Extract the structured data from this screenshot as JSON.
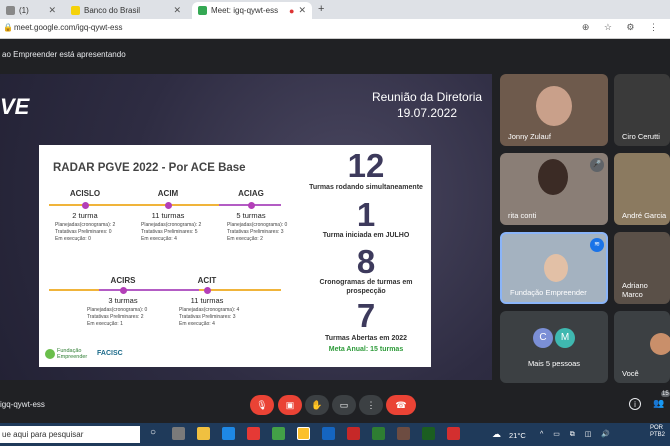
{
  "browser": {
    "tabs": [
      {
        "label": "(1)",
        "active": false
      },
      {
        "label": "Banco do Brasil",
        "active": false
      },
      {
        "label": "Meet: igq-qywt-ess",
        "active": true
      }
    ],
    "new_tab": "+",
    "url": "meet.google.com/igq-qywt-ess"
  },
  "presenting_text": "ao Empreender está apresentando",
  "slide": {
    "logo_partial": "VE",
    "meeting_title": "Reunião da Diretoria",
    "meeting_date": "19.07.2022",
    "card_title": "RADAR PGVE 2022 - Por ACE Base",
    "groups": [
      {
        "name": "ACISLO",
        "turmas": "2 turma",
        "details": [
          "Planejadas(cronograma): 2",
          "Tratativas Preliminares: 0",
          "Em execução: 0"
        ]
      },
      {
        "name": "ACIM",
        "turmas": "11 turmas",
        "details": [
          "Planejadas(cronograma): 2",
          "Tratativas Preliminares: 5",
          "Em execução: 4"
        ]
      },
      {
        "name": "ACIAG",
        "turmas": "5 turmas",
        "details": [
          "Planejadas(cronograma): 0",
          "Tratativas Preliminares: 3",
          "Em execução: 2"
        ]
      },
      {
        "name": "ACIRS",
        "turmas": "3 turmas",
        "details": [
          "Planejadas(cronograma): 0",
          "Tratativas Preliminares: 2",
          "Em execução: 1"
        ]
      },
      {
        "name": "ACIT",
        "turmas": "11 turmas",
        "details": [
          "Planejadas(cronograma): 4",
          "Tratativas Preliminares: 3",
          "Em execução: 4"
        ]
      }
    ],
    "stats": [
      {
        "number": "12",
        "label": "Turmas rodando simultaneamente"
      },
      {
        "number": "1",
        "label": "Turma iniciada em JULHO"
      },
      {
        "number": "8",
        "label": "Cronogramas de turmas em prospecção"
      },
      {
        "number": "7",
        "label": "Turmas Abertas em 2022"
      }
    ],
    "meta_anual": "Meta Anual: 15 turmas",
    "logo_fundacao": "Fundação Empreender",
    "logo_facisc": "FACISC"
  },
  "participants": [
    {
      "name": "Jonny Zulauf"
    },
    {
      "name": "Ciro Cerutti"
    },
    {
      "name": "rita conti"
    },
    {
      "name": "André Garcia"
    },
    {
      "name": "Fundação Empreender"
    },
    {
      "name": "Adriano Marco"
    },
    {
      "name": "Mais 5 pessoas",
      "avatars": [
        "C",
        "M"
      ]
    },
    {
      "name": "Você"
    }
  ],
  "meeting_code": "igq-qywt-ess",
  "people_count": "15",
  "taskbar": {
    "search_placeholder": "ue aqui para pesquisar",
    "weather": "21°C",
    "lang": "POR",
    "layout": "PTB2"
  },
  "colors": {
    "end_call": "#ea4335",
    "accent_line": "#f0b43a",
    "dot": "#b33fb8",
    "meta_green": "#2e9b3a"
  }
}
